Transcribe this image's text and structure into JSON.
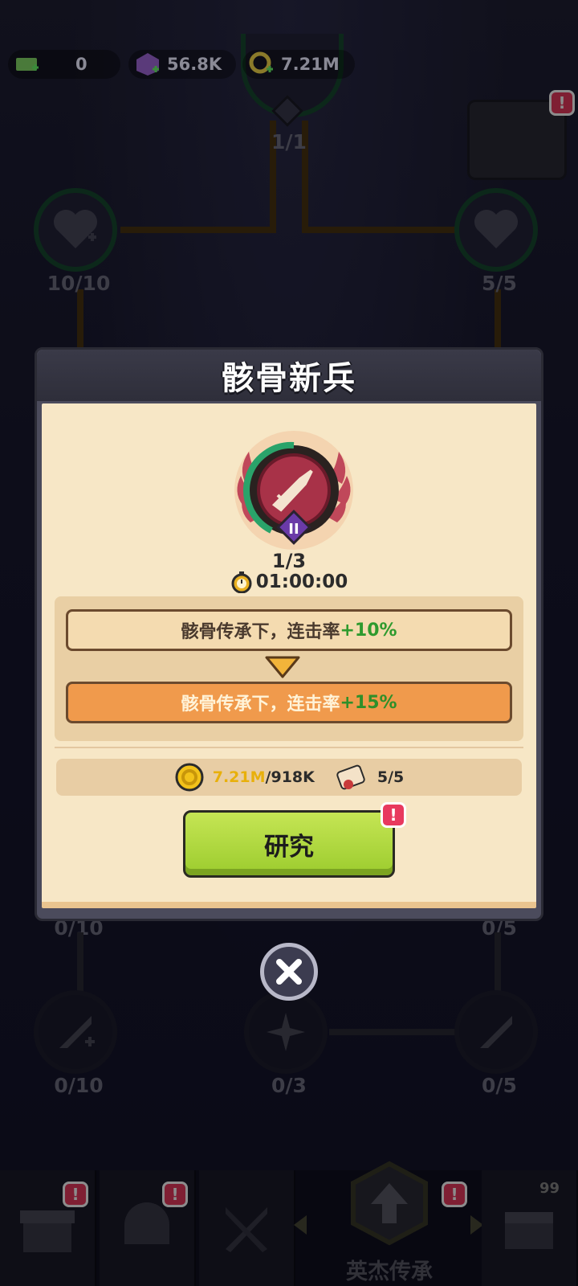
{
  "currencies": [
    {
      "icon": "cash-icon",
      "value": "0"
    },
    {
      "icon": "purple-gem-icon",
      "value": "56.8K"
    },
    {
      "icon": "gold-key-icon",
      "value": "7.21M"
    }
  ],
  "tree": {
    "top_count": "1/1",
    "nodes": [
      {
        "icon": "heart-plus-icon",
        "count": "10/10"
      },
      {
        "icon": "heart-up-icon",
        "count": "5/5"
      },
      {
        "icon": "sword-plus-icon",
        "count": "0/10"
      },
      {
        "icon": "sparkle-icon",
        "count": "0/3"
      },
      {
        "icon": "sword-up-icon",
        "count": "0/5"
      }
    ],
    "hidden_counts": [
      "0/10",
      "0/5"
    ]
  },
  "modal": {
    "title": "骸骨新兵",
    "skill_icon": "sword-icon",
    "skill_tier": "II",
    "level": "1/3",
    "timer": "01:00:00",
    "current_effect": {
      "text": "骸骨传承下，连击率",
      "bonus": "+10%"
    },
    "next_effect": {
      "text": "骸骨传承下，连击率",
      "bonus": "+15%"
    },
    "cost": {
      "gold": "7.21M",
      "gold_required": "/918K",
      "scroll": "5/5"
    },
    "research_label": "研究",
    "research_badge": "!"
  },
  "bottom_nav": {
    "active_label": "英杰传承",
    "chest_count": "99",
    "badge": "!"
  },
  "colors": {
    "accent_green": "#9ccc2e",
    "bonus_green": "#2e9a2e",
    "next_orange": "#f09a4c",
    "badge_red": "#e8395e"
  }
}
